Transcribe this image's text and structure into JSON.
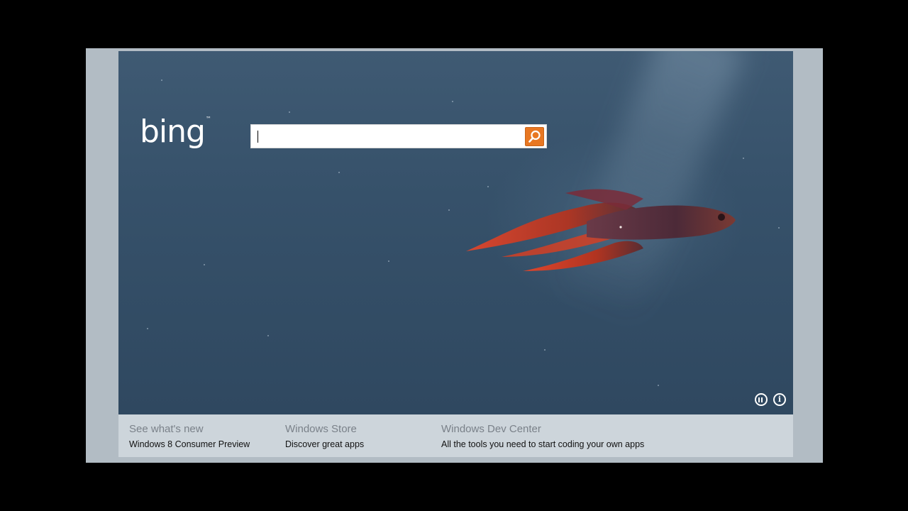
{
  "branding": {
    "logo_text": "bing",
    "trademark": "™",
    "accent_color": "#e87722"
  },
  "search": {
    "value": "",
    "placeholder": "",
    "button_icon": "search-icon"
  },
  "hero": {
    "image_subject": "betta fish underwater",
    "controls": [
      {
        "icon": "pause-icon"
      },
      {
        "icon": "info-icon"
      }
    ]
  },
  "footer": {
    "links": [
      {
        "title": "See what's new",
        "subtitle": "Windows 8 Consumer Preview"
      },
      {
        "title": "Windows Store",
        "subtitle": "Discover great apps"
      },
      {
        "title": "Windows Dev Center",
        "subtitle": "All the tools you need to start coding your own apps"
      }
    ]
  }
}
